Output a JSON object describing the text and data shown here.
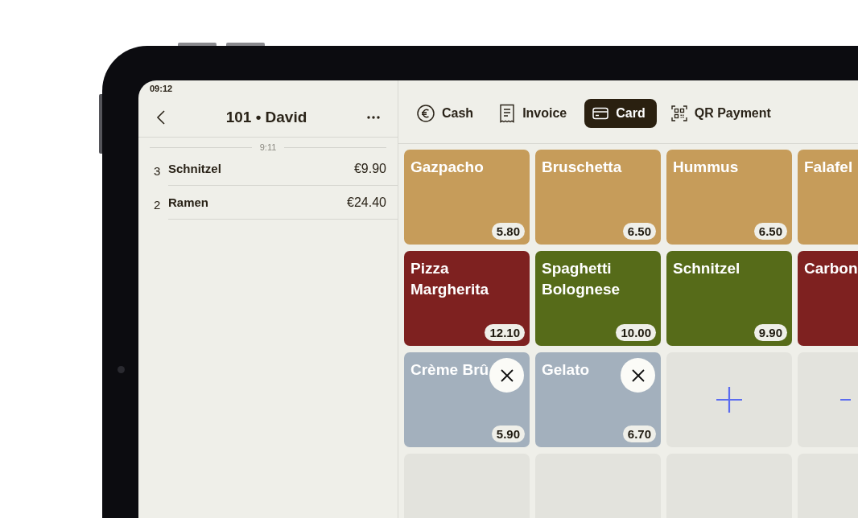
{
  "status_bar": {
    "time": "09:12"
  },
  "order": {
    "title": "101 • David",
    "time_divider": "9:11",
    "lines": [
      {
        "qty": "3",
        "name": "Schnitzel",
        "price": "€9.90"
      },
      {
        "qty": "2",
        "name": "Ramen",
        "price": "€24.40"
      }
    ]
  },
  "payment_tabs": [
    {
      "label": "Cash",
      "kind": "cash",
      "selected": false
    },
    {
      "label": "Invoice",
      "kind": "invoice",
      "selected": false
    },
    {
      "label": "Card",
      "kind": "card",
      "selected": true
    },
    {
      "label": "QR Payment",
      "kind": "qr",
      "selected": false
    }
  ],
  "tiles": [
    {
      "kind": "item",
      "name": "Gazpacho",
      "price": "5.80",
      "color": "#c69c5a",
      "removable": false
    },
    {
      "kind": "item",
      "name": "Bruschetta",
      "price": "6.50",
      "color": "#c69c5a",
      "removable": false
    },
    {
      "kind": "item",
      "name": "Hummus",
      "price": "6.50",
      "color": "#c69c5a",
      "removable": false
    },
    {
      "kind": "item",
      "name": "Falafel",
      "color": "#c69c5a",
      "removable": false
    },
    {
      "kind": "item",
      "name": "Pizza Margherita",
      "price": "12.10",
      "color": "#7e2120",
      "removable": false
    },
    {
      "kind": "item",
      "name": "Spaghetti Bolognese",
      "price": "10.00",
      "color": "#566b19",
      "removable": false
    },
    {
      "kind": "item",
      "name": "Schnitzel",
      "price": "9.90",
      "color": "#566b19",
      "removable": false
    },
    {
      "kind": "item",
      "name": "Carbon",
      "color": "#7e2120",
      "removable": false
    },
    {
      "kind": "item",
      "name": "Crème Brû",
      "price": "5.90",
      "color": "#a3b0bd",
      "removable": true
    },
    {
      "kind": "item",
      "name": "Gelato",
      "price": "6.70",
      "color": "#a3b0bd",
      "removable": true
    },
    {
      "kind": "add"
    },
    {
      "kind": "add"
    },
    {
      "kind": "empty"
    },
    {
      "kind": "empty"
    },
    {
      "kind": "empty"
    },
    {
      "kind": "empty"
    }
  ]
}
